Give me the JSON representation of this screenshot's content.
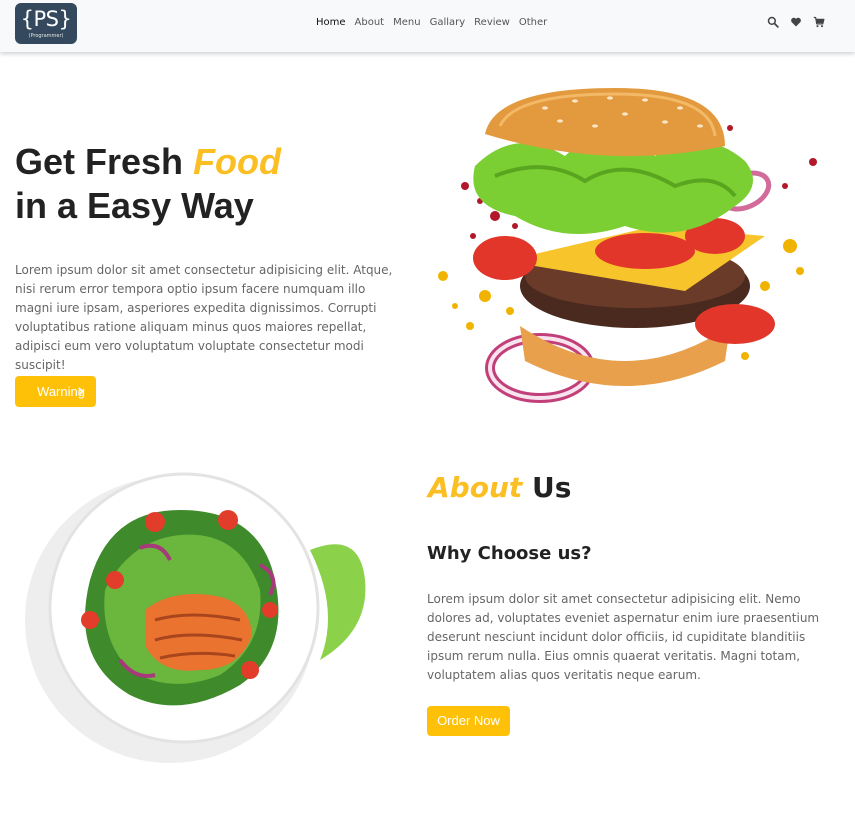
{
  "navbar": {
    "logo_main": "{PS}",
    "logo_sub": "(Programmer)",
    "links": [
      "Home",
      "About",
      "Menu",
      "Gallary",
      "Review",
      "Other"
    ],
    "icons": [
      "search-icon",
      "heart-icon",
      "cart-icon"
    ]
  },
  "hero": {
    "title_part1": "Get Fresh ",
    "title_accent": "Food",
    "title_line2": "in a Easy Way",
    "paragraph": "Lorem ipsum dolor sit amet consectetur adipisicing elit. Atque, nisi rerum error tempora optio ipsum facere numquam illo magni iure ipsam, asperiores expedita dignissimos. Corrupti voluptatibus ratione aliquam minus quos maiores repellat, adipisci eum vero voluptatum voluptate consectetur modi suscipit!",
    "button_label": "Warning"
  },
  "about": {
    "title_accent": "About",
    "title_rest": " Us",
    "subtitle": "Why Choose us?",
    "paragraph": "Lorem ipsum dolor sit amet consectetur adipisicing elit. Nemo dolores ad, voluptates eveniet aspernatur enim iure praesentium deserunt nesciunt incidunt dolor officiis, id cupiditate blanditiis ipsum rerum nulla. Eius omnis quaerat veritatis. Magni totam, voluptatem alias quos veritatis neque earum.",
    "button_label": "Order Now"
  },
  "colors": {
    "accent": "#fbbf24",
    "button": "#ffc107",
    "logo_bg": "#34495e",
    "navbar_bg": "#f8f9fa"
  }
}
